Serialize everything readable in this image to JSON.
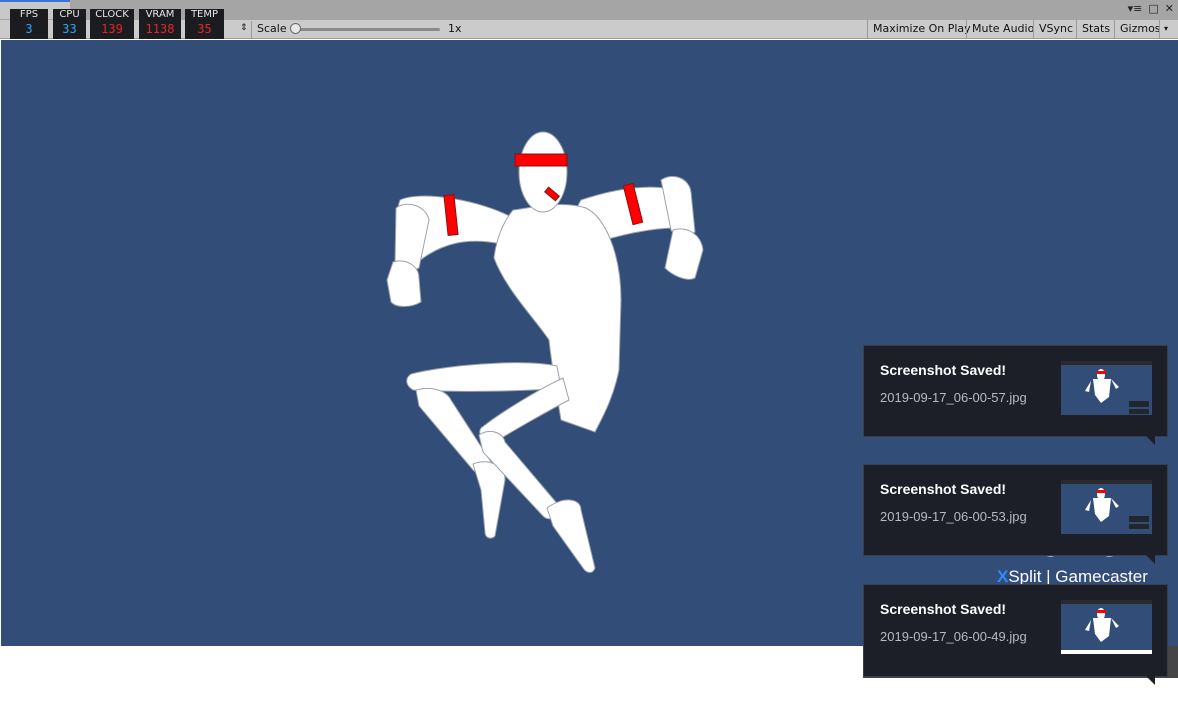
{
  "editor": {
    "window_controls": [
      "▾≡",
      "□",
      "✕"
    ]
  },
  "toolbar": {
    "scale_label": "Scale",
    "scale_value": "1x",
    "scale_level": 0.0,
    "buttons": [
      "Maximize On Play",
      "Mute Audio",
      "VSync",
      "Stats",
      "Gizmos"
    ],
    "gizmos_arrow": "▾"
  },
  "hw_monitor": [
    {
      "label": "FPS",
      "value": "3",
      "color": "#2aa7ff"
    },
    {
      "label": "CPU",
      "value": "33",
      "color": "#2aa7ff"
    },
    {
      "label": "CLOCK",
      "value": "139",
      "color": "#e8242a"
    },
    {
      "label": "VRAM",
      "value": "1138",
      "color": "#e8242a"
    },
    {
      "label": "TEMP",
      "value": "35",
      "color": "#e8242a"
    }
  ],
  "viewport": {
    "background": "#324d78",
    "character_color": "#ffffff",
    "accent_color": "#ff0000"
  },
  "notifications": [
    {
      "title": "Screenshot Saved!",
      "filename": "2019-09-17_06-00-57.jpg"
    },
    {
      "title": "Screenshot Saved!",
      "filename": "2019-09-17_06-00-53.jpg"
    },
    {
      "title": "Screenshot Saved!",
      "filename": "2019-09-17_06-00-49.jpg"
    }
  ],
  "watermark": {
    "x": "X",
    "text": "Split | Gamecaster"
  }
}
